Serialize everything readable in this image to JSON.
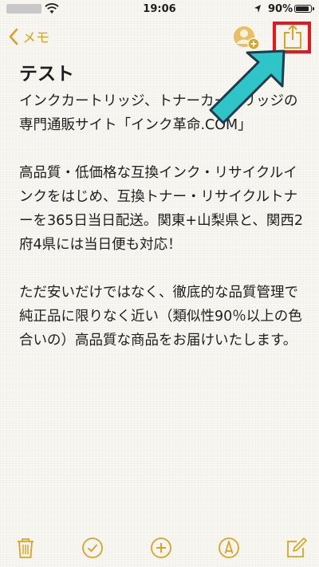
{
  "status_bar": {
    "time": "19:06",
    "battery_percent": "90%",
    "battery_level": 0.9
  },
  "nav": {
    "back_label": "メモ",
    "accent_color": "#d9a426"
  },
  "note": {
    "title": "テスト",
    "paragraphs": [
      "インクカートリッジ、トナーカートリッジの専門通販サイト「インク革命.COM」",
      "高品質・低価格な互換インク・リサイクルインクをはじめ、互換トナー・リサイクルトナーを365日当日配送。関東+山梨県と、関西2府4県には当日便も対応！",
      "ただ安いだけではなく、徹底的な品質管理で純正品に限りなく近い（類似性90％以上の色合いの）高品質な商品をお届けいたします。"
    ]
  },
  "annotation": {
    "highlight_color": "#e8171f",
    "arrow_color": "#2ec4c8"
  },
  "toolbar": {
    "icons": [
      "trash-icon",
      "checklist-icon",
      "add-icon",
      "markup-icon",
      "compose-icon"
    ]
  }
}
